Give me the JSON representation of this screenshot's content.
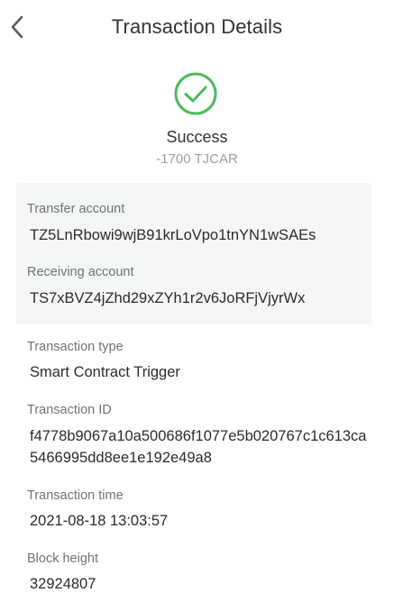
{
  "header": {
    "title": "Transaction Details",
    "back_icon": "chevron-left-icon"
  },
  "status": {
    "icon": "check-circle-icon",
    "label": "Success",
    "amount": "-1700 TJCAR",
    "color": "#4cbb5c"
  },
  "accounts": {
    "transfer_label": "Transfer account",
    "transfer_value": "TZ5LnRbowi9wjB91krLoVpo1tnYN1wSAEs",
    "receiving_label": "Receiving account",
    "receiving_value": "TS7xBVZ4jZhd29xZYh1r2v6JoRFjVjyrWx"
  },
  "details": {
    "type_label": "Transaction type",
    "type_value": "Smart Contract Trigger",
    "txid_label": "Transaction ID",
    "txid_value": "f4778b9067a10a500686f1077e5b020767c1c613ca5466995dd8ee1e192e49a8",
    "time_label": "Transaction time",
    "time_value": "2021-08-18 13:03:57",
    "block_label": "Block height",
    "block_value": "32924807"
  }
}
